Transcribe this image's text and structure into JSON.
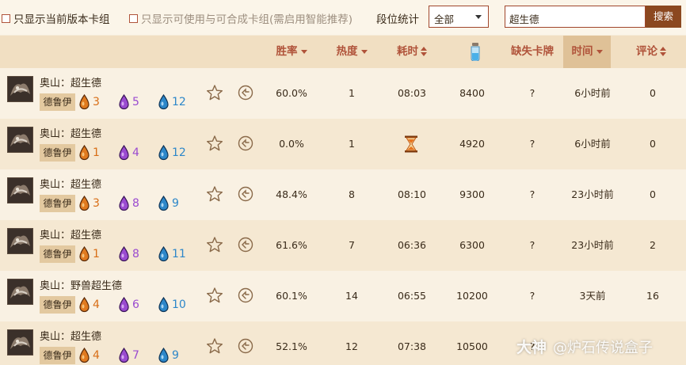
{
  "filters": {
    "checkbox1": "只显示当前版本卡组",
    "checkbox2": "只显示可使用与可合成卡组(需启用智能推荐)",
    "rank_label": "段位统计",
    "rank_select": "全部",
    "search_value": "超生德",
    "search_button": "搜索"
  },
  "columns": {
    "winrate": "胜率",
    "heat": "热度",
    "time": "耗时",
    "missing": "缺失卡牌",
    "updated": "时间",
    "comments": "评论"
  },
  "rows": [
    {
      "name": "奥山：超生德",
      "class": "德鲁伊",
      "orange": "3",
      "purple": "5",
      "blue": "12",
      "winrate": "60.0%",
      "heat": "1",
      "duration": "08:03",
      "dust": "8400",
      "missing": "?",
      "updated": "6小时前",
      "comments": "0"
    },
    {
      "name": "奥山：超生德",
      "class": "德鲁伊",
      "orange": "1",
      "purple": "4",
      "blue": "12",
      "winrate": "0.0%",
      "heat": "1",
      "duration": "",
      "dust": "4920",
      "missing": "?",
      "updated": "6小时前",
      "comments": "0"
    },
    {
      "name": "奥山：超生德",
      "class": "德鲁伊",
      "orange": "3",
      "purple": "8",
      "blue": "9",
      "winrate": "48.4%",
      "heat": "8",
      "duration": "08:10",
      "dust": "9300",
      "missing": "?",
      "updated": "23小时前",
      "comments": "0"
    },
    {
      "name": "奥山：超生德",
      "class": "德鲁伊",
      "orange": "1",
      "purple": "8",
      "blue": "11",
      "winrate": "61.6%",
      "heat": "7",
      "duration": "06:36",
      "dust": "6300",
      "missing": "?",
      "updated": "23小时前",
      "comments": "2"
    },
    {
      "name": "奥山：野兽超生德",
      "class": "德鲁伊",
      "orange": "4",
      "purple": "6",
      "blue": "10",
      "winrate": "60.1%",
      "heat": "14",
      "duration": "06:55",
      "dust": "10200",
      "missing": "?",
      "updated": "3天前",
      "comments": "16"
    },
    {
      "name": "奥山：超生德",
      "class": "德鲁伊",
      "orange": "4",
      "purple": "7",
      "blue": "9",
      "winrate": "52.1%",
      "heat": "12",
      "duration": "07:38",
      "dust": "10500",
      "missing": "?",
      "updated": "",
      "comments": ""
    }
  ],
  "watermark": {
    "brand": "大神",
    "text": "@炉石传说盒子"
  },
  "colors": {
    "accent": "#b0533a",
    "button": "#8b4820",
    "orange": "#d86e17",
    "purple": "#9a4bd0",
    "blue": "#2d87c9"
  },
  "icons": [
    "star-icon",
    "retro-icon",
    "dust-vial-icon",
    "hourglass-icon",
    "orange-gem-icon",
    "purple-gem-icon",
    "blue-gem-icon"
  ]
}
